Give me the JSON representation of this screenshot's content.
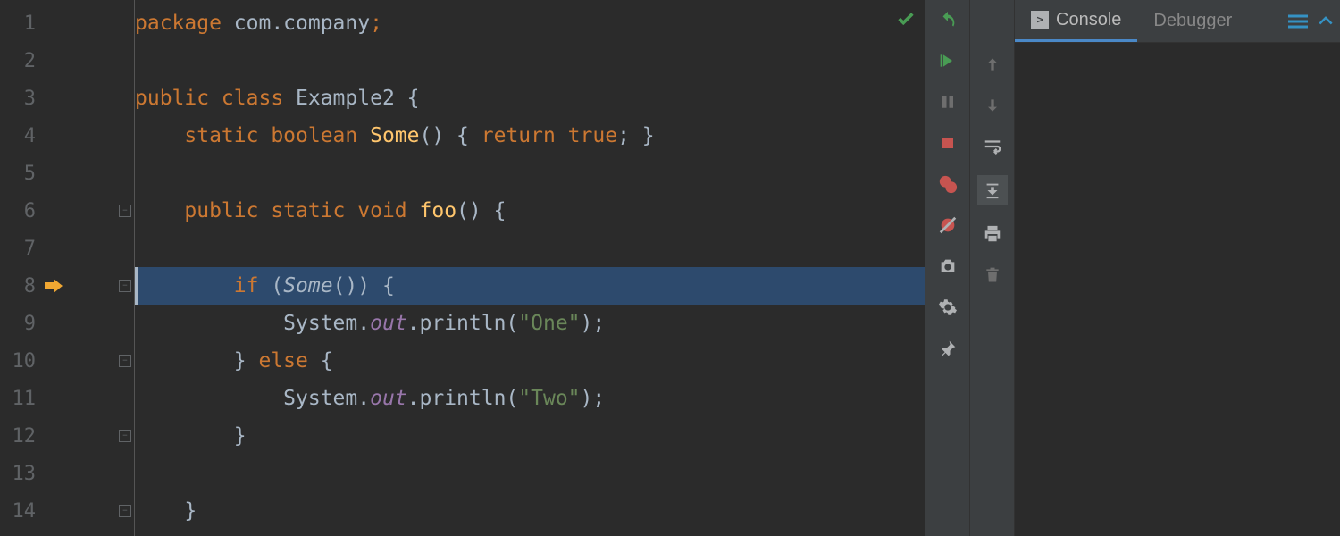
{
  "editor": {
    "current_line": 8,
    "fold_lines": [
      6,
      8,
      10,
      12,
      14
    ],
    "lines": [
      {
        "num": 1,
        "tokens": [
          {
            "t": "package ",
            "c": "k-keyword"
          },
          {
            "t": "com.company",
            "c": "k-punct"
          },
          {
            "t": ";",
            "c": "k-keyword"
          }
        ]
      },
      {
        "num": 2,
        "tokens": []
      },
      {
        "num": 3,
        "tokens": [
          {
            "t": "public class ",
            "c": "k-keyword"
          },
          {
            "t": "Example2 ",
            "c": "k-classname"
          },
          {
            "t": "{",
            "c": "k-punct"
          }
        ]
      },
      {
        "num": 4,
        "tokens": [
          {
            "t": "    ",
            "c": ""
          },
          {
            "t": "static boolean ",
            "c": "k-keyword"
          },
          {
            "t": "Some",
            "c": "k-method"
          },
          {
            "t": "() { ",
            "c": "k-punct"
          },
          {
            "t": "return true",
            "c": "k-keyword"
          },
          {
            "t": "; }",
            "c": "k-punct"
          }
        ]
      },
      {
        "num": 5,
        "tokens": []
      },
      {
        "num": 6,
        "tokens": [
          {
            "t": "    ",
            "c": ""
          },
          {
            "t": "public static void ",
            "c": "k-keyword"
          },
          {
            "t": "foo",
            "c": "k-method"
          },
          {
            "t": "() {",
            "c": "k-punct"
          }
        ]
      },
      {
        "num": 7,
        "tokens": []
      },
      {
        "num": 8,
        "highlighted": true,
        "tokens": [
          {
            "t": "        ",
            "c": ""
          },
          {
            "t": "if ",
            "c": "k-keyword"
          },
          {
            "t": "(",
            "c": "k-punct"
          },
          {
            "t": "Some",
            "c": "k-call-italic"
          },
          {
            "t": "()) {",
            "c": "k-punct"
          }
        ]
      },
      {
        "num": 9,
        "tokens": [
          {
            "t": "            System.",
            "c": "k-punct"
          },
          {
            "t": "out",
            "c": "k-field"
          },
          {
            "t": ".println(",
            "c": "k-punct"
          },
          {
            "t": "\"One\"",
            "c": "k-string"
          },
          {
            "t": ");",
            "c": "k-punct"
          }
        ]
      },
      {
        "num": 10,
        "tokens": [
          {
            "t": "        } ",
            "c": "k-punct"
          },
          {
            "t": "else ",
            "c": "k-keyword"
          },
          {
            "t": "{",
            "c": "k-punct"
          }
        ]
      },
      {
        "num": 11,
        "tokens": [
          {
            "t": "            System.",
            "c": "k-punct"
          },
          {
            "t": "out",
            "c": "k-field"
          },
          {
            "t": ".println(",
            "c": "k-punct"
          },
          {
            "t": "\"Two\"",
            "c": "k-string"
          },
          {
            "t": ");",
            "c": "k-punct"
          }
        ]
      },
      {
        "num": 12,
        "tokens": [
          {
            "t": "        }",
            "c": "k-punct"
          }
        ]
      },
      {
        "num": 13,
        "tokens": []
      },
      {
        "num": 14,
        "tokens": [
          {
            "t": "    }",
            "c": "k-punct"
          }
        ]
      }
    ]
  },
  "tabs": {
    "console": "Console",
    "debugger": "Debugger"
  }
}
